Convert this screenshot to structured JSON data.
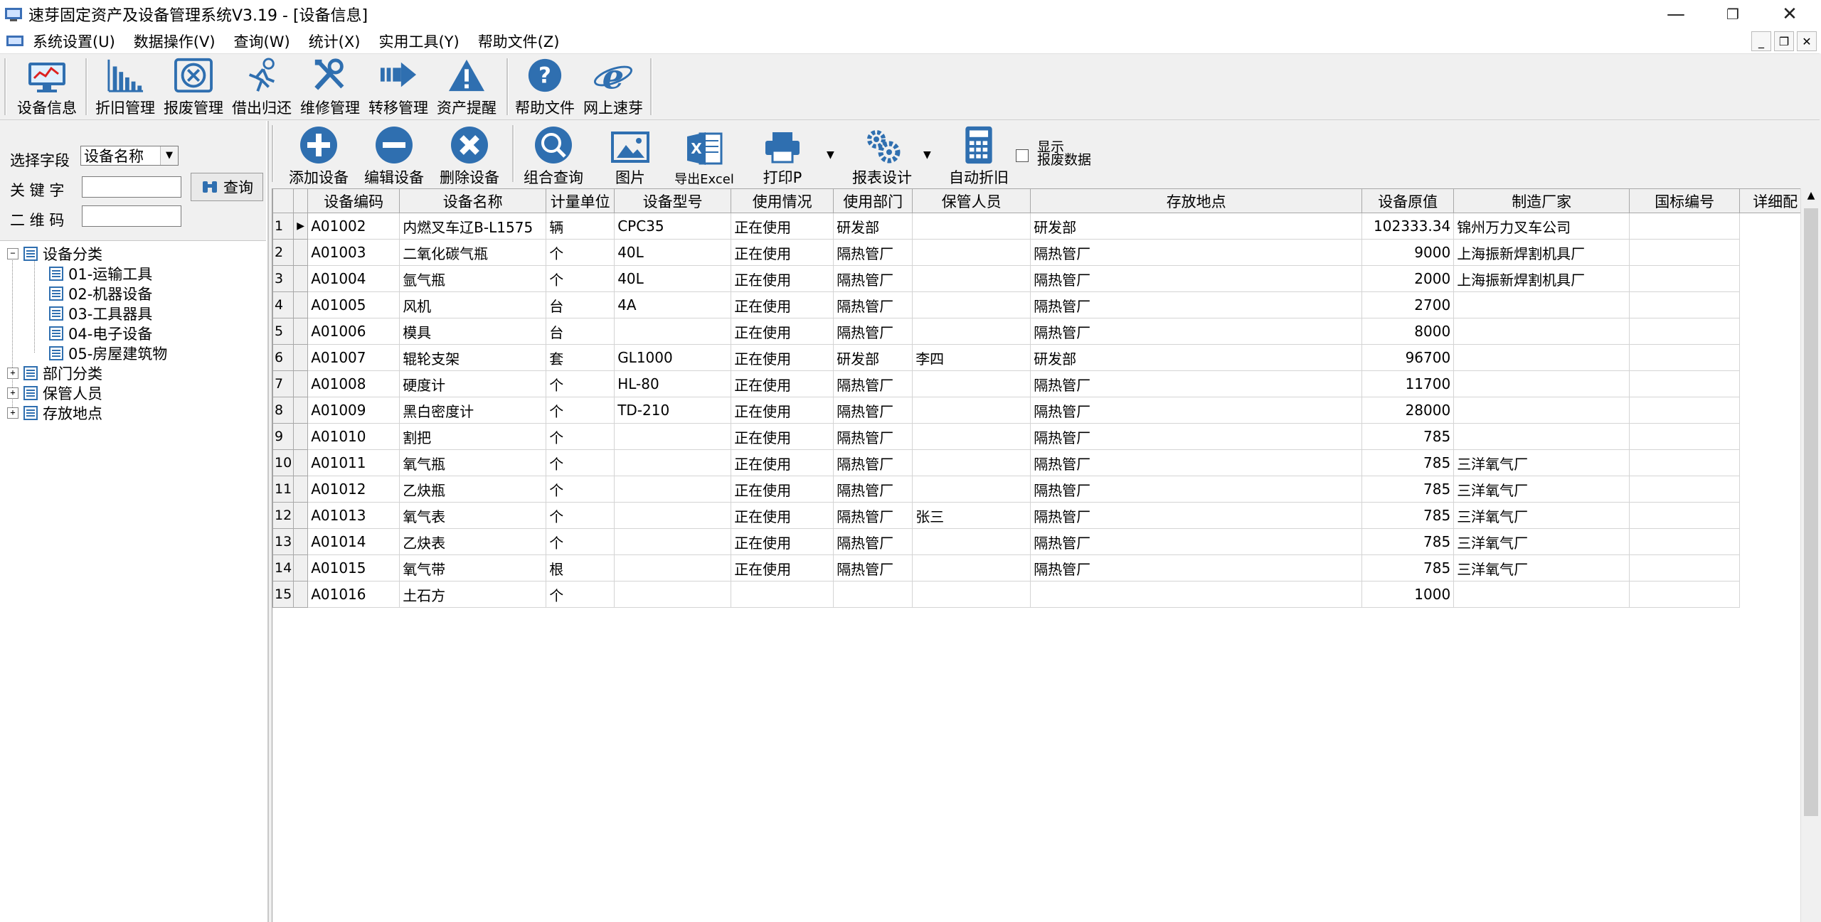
{
  "window": {
    "title": "速芽固定资产及设备管理系统V3.19 - [设备信息]"
  },
  "menu": [
    "系统设置(U)",
    "数据操作(V)",
    "查询(W)",
    "统计(X)",
    "实用工具(Y)",
    "帮助文件(Z)"
  ],
  "toolbar_main": [
    {
      "label": "设备信息",
      "icon": "monitor-chart-icon"
    },
    {
      "label": "折旧管理",
      "icon": "bar-chart-icon"
    },
    {
      "label": "报废管理",
      "icon": "scrap-x-icon"
    },
    {
      "label": "借出归还",
      "icon": "runner-icon"
    },
    {
      "label": "维修管理",
      "icon": "tools-icon"
    },
    {
      "label": "转移管理",
      "icon": "transfer-arrow-icon"
    },
    {
      "label": "资产提醒",
      "icon": "warning-icon"
    },
    {
      "label": "帮助文件",
      "icon": "help-icon"
    },
    {
      "label": "网上速芽",
      "icon": "ie-browser-icon"
    }
  ],
  "search": {
    "field_label": "选择字段",
    "field_value": "设备名称",
    "keyword_label": "关 键 字",
    "keyword_value": "",
    "qrcode_label": "二 维 码",
    "qrcode_value": "",
    "query_button": "查询"
  },
  "tree": {
    "root": "设备分类",
    "children": [
      "01-运输工具",
      "02-机器设备",
      "03-工具器具",
      "04-电子设备",
      "05-房屋建筑物"
    ],
    "others": [
      "部门分类",
      "保管人员",
      "存放地点"
    ]
  },
  "toolbar_grid": [
    {
      "label": "添加设备",
      "icon": "add-icon"
    },
    {
      "label": "编辑设备",
      "icon": "edit-minus-icon"
    },
    {
      "label": "删除设备",
      "icon": "delete-icon"
    },
    {
      "label": "组合查询",
      "icon": "magnifier-icon"
    },
    {
      "label": "图片",
      "icon": "picture-icon"
    },
    {
      "label": "导出Excel",
      "icon": "excel-icon"
    },
    {
      "label": "打印P",
      "icon": "printer-icon"
    },
    {
      "label": "报表设计",
      "icon": "gears-icon"
    },
    {
      "label": "自动折旧",
      "icon": "calculator-icon"
    }
  ],
  "show_scrapped": {
    "line1": "显示",
    "line2": "报废数据",
    "checked": false
  },
  "table": {
    "columns": [
      "设备编码",
      "设备名称",
      "计量单位",
      "设备型号",
      "使用情况",
      "使用部门",
      "保管人员",
      "存放地点",
      "设备原值",
      "制造厂家",
      "国标编号",
      "详细配"
    ],
    "rows": [
      [
        "1",
        "A01002",
        "内燃叉车辽B-L1575",
        "辆",
        "CPC35",
        "正在使用",
        "研发部",
        "",
        "研发部",
        "102333.34",
        "锦州万力叉车公司",
        ""
      ],
      [
        "2",
        "A01003",
        "二氧化碳气瓶",
        "个",
        "40L",
        "正在使用",
        "隔热管厂",
        "",
        "隔热管厂",
        "9000",
        "上海振新焊割机具厂",
        ""
      ],
      [
        "3",
        "A01004",
        "氩气瓶",
        "个",
        "40L",
        "正在使用",
        "隔热管厂",
        "",
        "隔热管厂",
        "2000",
        "上海振新焊割机具厂",
        ""
      ],
      [
        "4",
        "A01005",
        "风机",
        "台",
        "4A",
        "正在使用",
        "隔热管厂",
        "",
        "隔热管厂",
        "2700",
        "",
        ""
      ],
      [
        "5",
        "A01006",
        "模具",
        "台",
        "",
        "正在使用",
        "隔热管厂",
        "",
        "隔热管厂",
        "8000",
        "",
        ""
      ],
      [
        "6",
        "A01007",
        "辊轮支架",
        "套",
        "GL1000",
        "正在使用",
        "研发部",
        "李四",
        "研发部",
        "96700",
        "",
        ""
      ],
      [
        "7",
        "A01008",
        "硬度计",
        "个",
        "HL-80",
        "正在使用",
        "隔热管厂",
        "",
        "隔热管厂",
        "11700",
        "",
        ""
      ],
      [
        "8",
        "A01009",
        "黑白密度计",
        "个",
        "TD-210",
        "正在使用",
        "隔热管厂",
        "",
        "隔热管厂",
        "28000",
        "",
        ""
      ],
      [
        "9",
        "A01010",
        "割把",
        "个",
        "",
        "正在使用",
        "隔热管厂",
        "",
        "隔热管厂",
        "785",
        "",
        ""
      ],
      [
        "10",
        "A01011",
        "氧气瓶",
        "个",
        "",
        "正在使用",
        "隔热管厂",
        "",
        "隔热管厂",
        "785",
        "三洋氧气厂",
        ""
      ],
      [
        "11",
        "A01012",
        "乙炔瓶",
        "个",
        "",
        "正在使用",
        "隔热管厂",
        "",
        "隔热管厂",
        "785",
        "三洋氧气厂",
        ""
      ],
      [
        "12",
        "A01013",
        "氧气表",
        "个",
        "",
        "正在使用",
        "隔热管厂",
        "张三",
        "隔热管厂",
        "785",
        "三洋氧气厂",
        ""
      ],
      [
        "13",
        "A01014",
        "乙炔表",
        "个",
        "",
        "正在使用",
        "隔热管厂",
        "",
        "隔热管厂",
        "785",
        "三洋氧气厂",
        ""
      ],
      [
        "14",
        "A01015",
        "氧气带",
        "根",
        "",
        "正在使用",
        "隔热管厂",
        "",
        "隔热管厂",
        "785",
        "三洋氧气厂",
        ""
      ],
      [
        "15",
        "A01016",
        "土石方",
        "个",
        "",
        "",
        "",
        "",
        "",
        "1000",
        "",
        ""
      ]
    ]
  }
}
